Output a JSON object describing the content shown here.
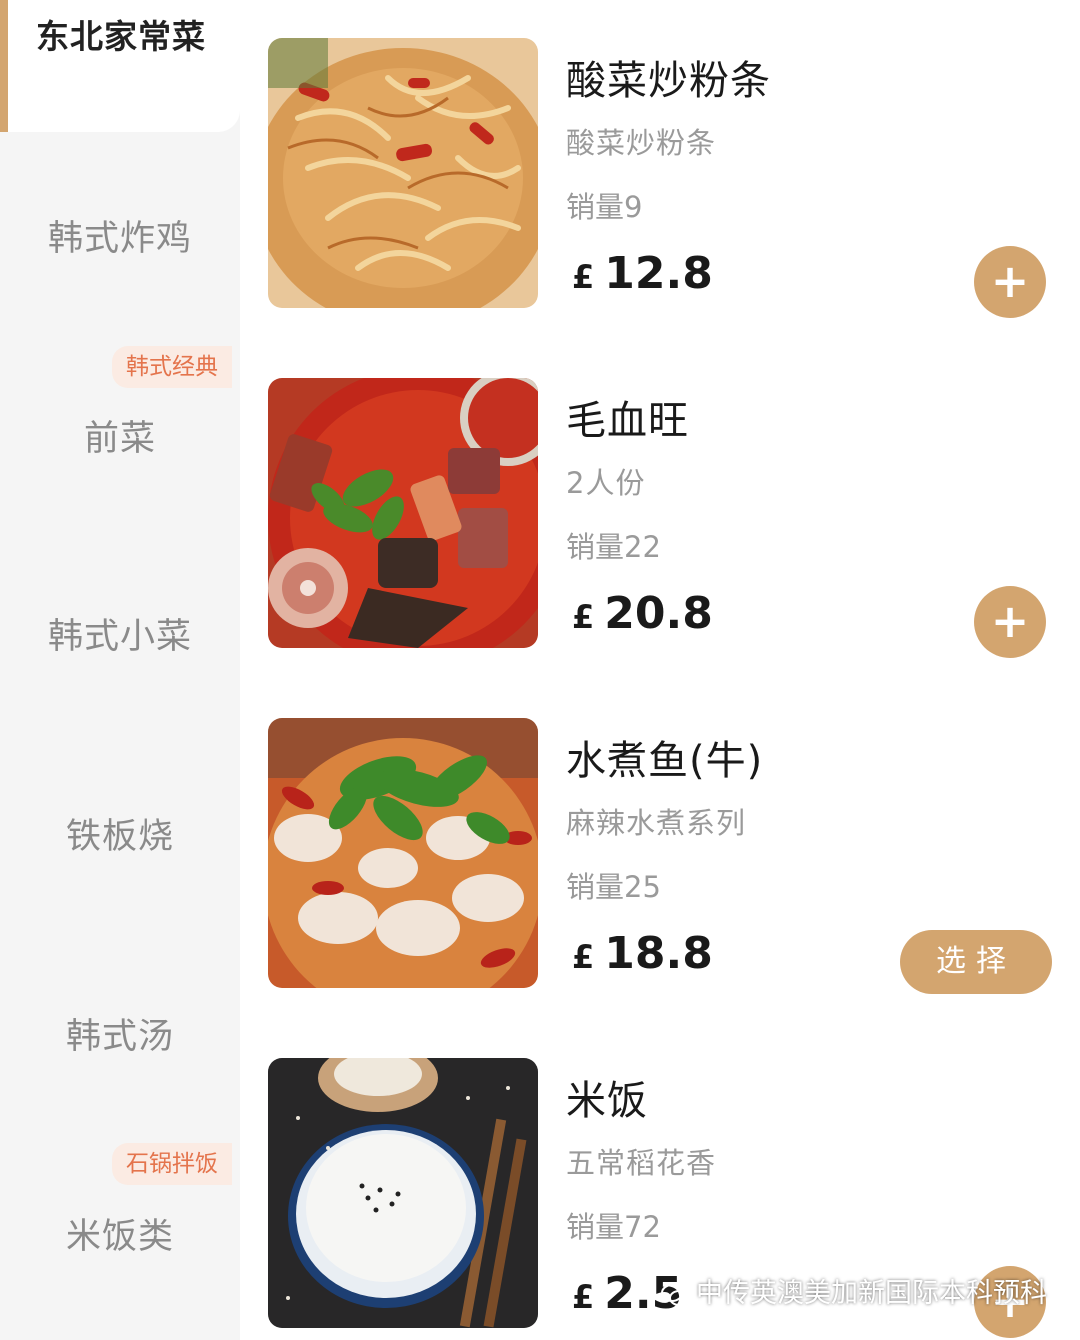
{
  "sidebar": {
    "active": "东北家常菜",
    "items": [
      {
        "label": "韩式炸鸡",
        "tag": ""
      },
      {
        "label": "前菜",
        "tag": "韩式经典"
      },
      {
        "label": "韩式小菜",
        "tag": ""
      },
      {
        "label": "铁板烧",
        "tag": ""
      },
      {
        "label": "韩式汤",
        "tag": ""
      },
      {
        "label": "米饭类",
        "tag": "石锅拌饭"
      }
    ]
  },
  "items": [
    {
      "name": "酸菜炒粉条",
      "desc": "酸菜炒粉条",
      "sales": "销量9",
      "currency": "£",
      "price": "12.8",
      "action": "+",
      "image": "stir-fried-noodles"
    },
    {
      "name": "毛血旺",
      "desc": "2人份",
      "sales": "销量22",
      "currency": "£",
      "price": "20.8",
      "action": "+",
      "image": "spicy-blood-stew"
    },
    {
      "name": "水煮鱼(牛)",
      "desc": "麻辣水煮系列",
      "sales": "销量25",
      "currency": "£",
      "price": "18.8",
      "action": "选择",
      "image": "boiled-fish"
    },
    {
      "name": "米饭",
      "desc": "五常稻花香",
      "sales": "销量72",
      "currency": "£",
      "price": "2.5",
      "action": "+",
      "image": "rice-bowl"
    }
  ],
  "watermark": "中传英澳美加新国际本科预科",
  "colors": {
    "accent": "#d3a56f",
    "tag_text": "#e4744c",
    "tag_bg": "#fbebe3"
  }
}
